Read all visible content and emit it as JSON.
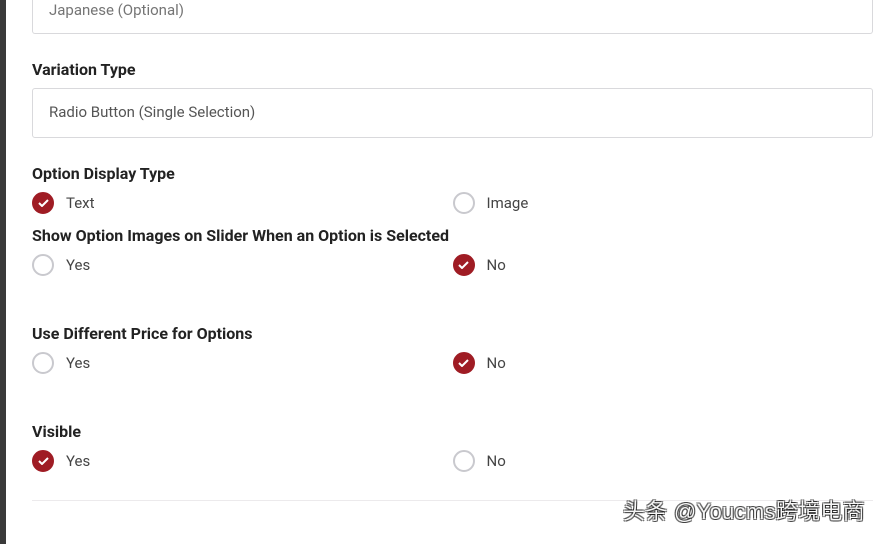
{
  "japanese_input": {
    "placeholder": "Japanese (Optional)"
  },
  "variation_type": {
    "label": "Variation Type",
    "value": "Radio Button (Single Selection)"
  },
  "option_display_type": {
    "label": "Option Display Type",
    "opt1": "Text",
    "opt2": "Image",
    "selected": "opt1"
  },
  "show_option_images": {
    "label": "Show Option Images on Slider When an Option is Selected",
    "opt1": "Yes",
    "opt2": "No",
    "selected": "opt2"
  },
  "use_different_price": {
    "label": "Use Different Price for Options",
    "opt1": "Yes",
    "opt2": "No",
    "selected": "opt2"
  },
  "visible": {
    "label": "Visible",
    "opt1": "Yes",
    "opt2": "No",
    "selected": "opt1"
  },
  "watermark": "头条 @Youcms跨境电商"
}
